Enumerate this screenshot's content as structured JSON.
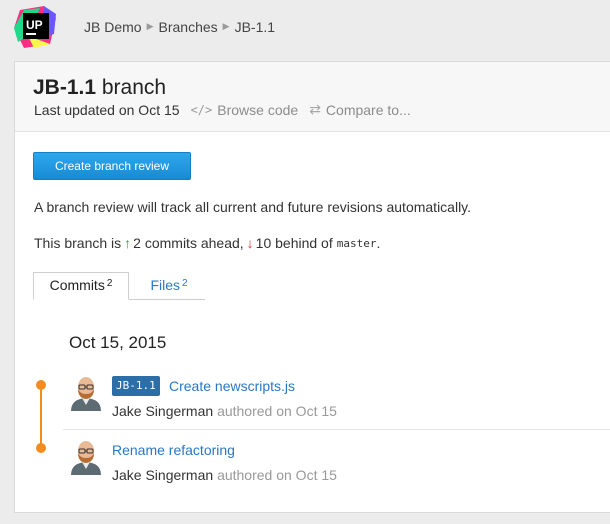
{
  "breadcrumb": {
    "project": "JB Demo",
    "section": "Branches",
    "current": "JB-1.1"
  },
  "header": {
    "branch_name": "JB-1.1",
    "branch_word": "branch",
    "last_updated": "Last updated on Oct 15",
    "browse_code": "Browse code",
    "compare_to": "Compare to..."
  },
  "actions": {
    "create_review_label": "Create branch review"
  },
  "info_text": "A branch review will track all current and future revisions automatically.",
  "ahead_behind": {
    "prefix": "This branch is",
    "ahead": "2 commits ahead,",
    "behind": "10 behind of",
    "base": "master",
    "suffix": "."
  },
  "tabs": [
    {
      "label": "Commits",
      "count": "2"
    },
    {
      "label": "Files",
      "count": "2"
    }
  ],
  "commits_date": "Oct 15, 2015",
  "commits": [
    {
      "branch_badge": "JB-1.1",
      "message": "Create newscripts.js",
      "author": "Jake Singerman",
      "authored": "authored on Oct 15"
    },
    {
      "branch_badge": "",
      "message": "Rename refactoring",
      "author": "Jake Singerman",
      "authored": "authored on Oct 15"
    }
  ],
  "colors": {
    "accent": "#f28c1e",
    "link": "#2a78c5",
    "button": "#178bd6",
    "badge": "#2b6ea8"
  }
}
